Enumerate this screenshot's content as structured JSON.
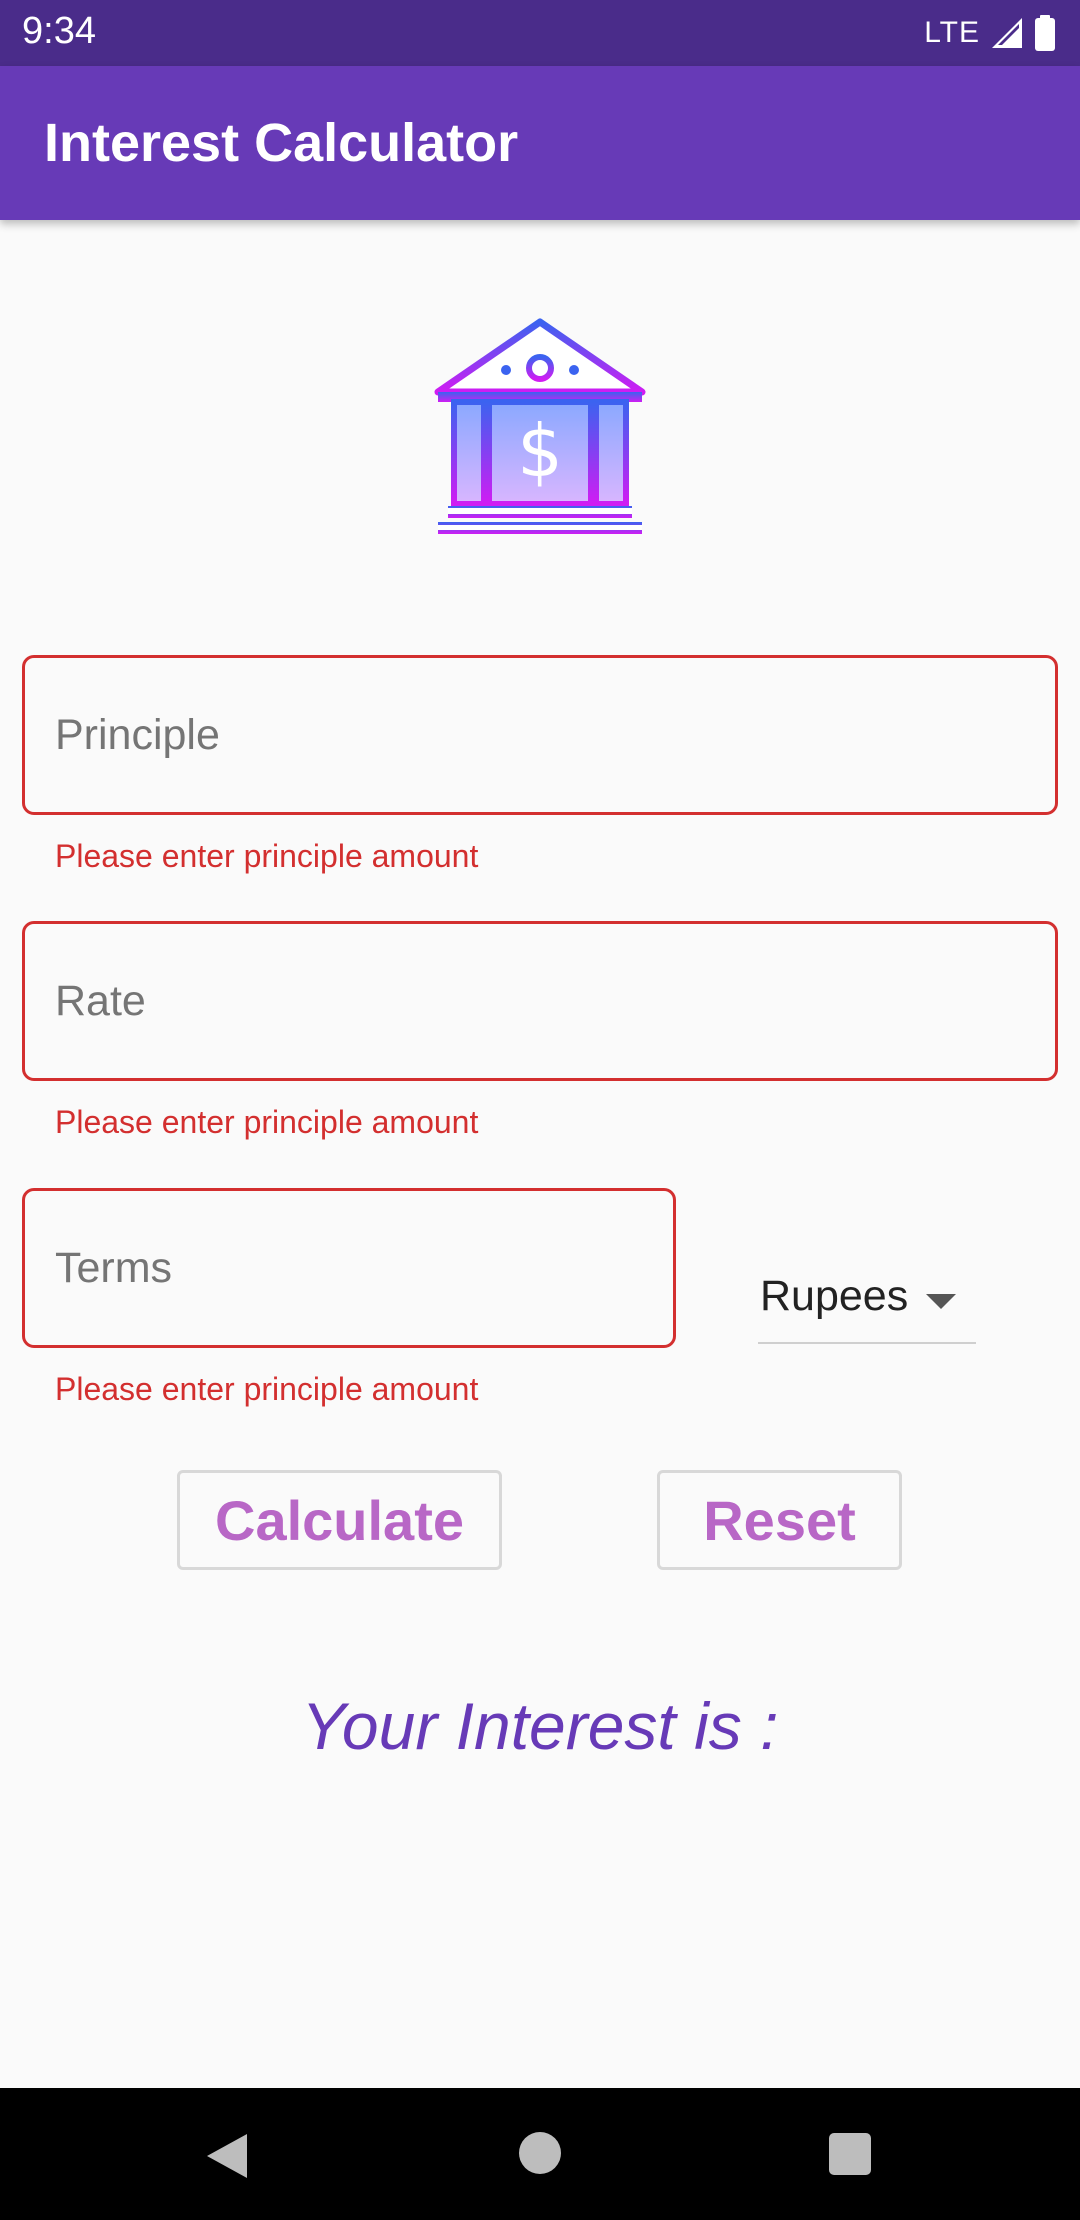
{
  "status_bar": {
    "time": "9:34",
    "network": "LTE",
    "signal_icon": "signal-icon",
    "battery_icon": "battery-icon"
  },
  "app_bar": {
    "title": "Interest Calculator"
  },
  "logo": {
    "icon": "bank-icon"
  },
  "form": {
    "principle": {
      "value": "",
      "placeholder": "Principle",
      "error": "Please enter principle amount"
    },
    "rate": {
      "value": "",
      "placeholder": "Rate",
      "error": "Please enter principle amount"
    },
    "terms": {
      "value": "",
      "placeholder": "Terms",
      "error": "Please enter principle amount"
    },
    "currency": {
      "selected": "Rupees"
    }
  },
  "buttons": {
    "calculate": "Calculate",
    "reset": "Reset"
  },
  "result": {
    "text": "Your Interest is :"
  },
  "colors": {
    "primary": "#673ab7",
    "status_bar": "#4a2c8a",
    "error": "#d32f2f",
    "button_text": "#b867c6"
  },
  "nav_bar": {
    "back_icon": "back-icon",
    "home_icon": "home-icon",
    "recents_icon": "recents-icon"
  }
}
